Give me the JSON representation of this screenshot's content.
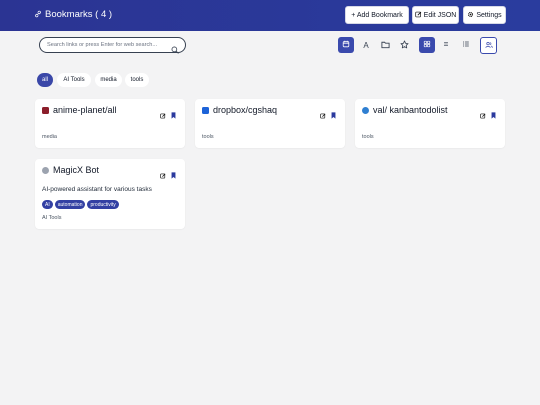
{
  "header": {
    "title": "Bookmarks ( 4 )",
    "title_icon": "link-icon",
    "add_label": "+ Add Bookmark",
    "edit_label": "Edit JSON",
    "settings_label": "Settings",
    "background": "#2b3493"
  },
  "search": {
    "placeholder": "Search links or press Enter for web search...",
    "value": ""
  },
  "toolbar": {
    "icons": [
      "calendar-icon",
      "alphabetical-sort-icon",
      "folder-icon",
      "star-icon",
      "grid-view-icon",
      "compact-view-icon",
      "list-view-icon",
      "user-group-icon"
    ],
    "active": [
      "calendar-icon",
      "grid-view-icon"
    ],
    "text_button": "A",
    "accent": "#3a4aad"
  },
  "filters": [
    "all",
    "AI Tools",
    "media",
    "tools"
  ],
  "active_filter": "all",
  "cards": [
    {
      "title": "anime-planet/all",
      "category": "media",
      "favicon_color": "#8b1e2b"
    },
    {
      "title": "dropbox/cgshaq",
      "category": "tools",
      "favicon_color": "#1d63d8"
    },
    {
      "title": "val/ kanbantodolist",
      "category": "tools",
      "favicon_color": "#2f7fd1"
    },
    {
      "title": "MagicX Bot",
      "category": "AI Tools",
      "description": "AI-powered assistant for various tasks",
      "tags": [
        "AI",
        "automation",
        "productivity"
      ],
      "favicon_color": "#9ca3af"
    }
  ]
}
